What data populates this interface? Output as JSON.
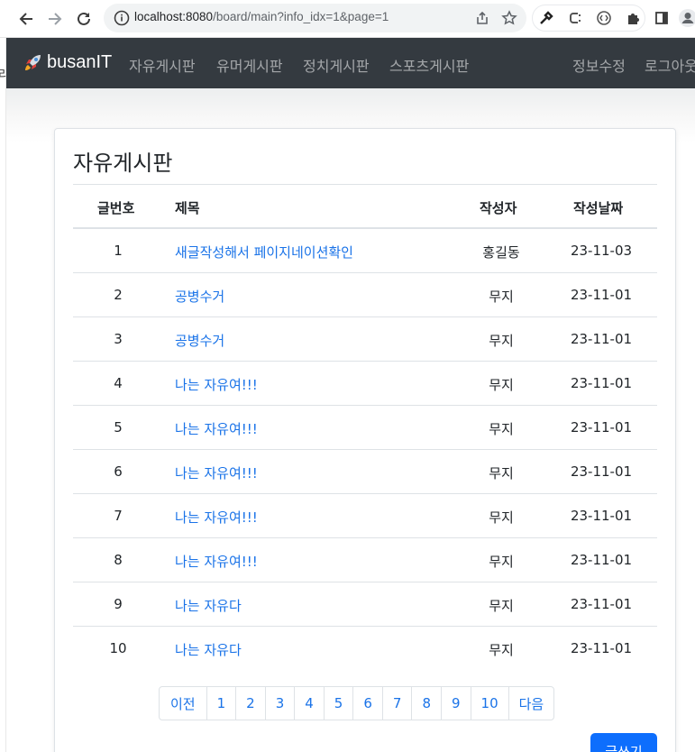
{
  "browser": {
    "url_host": "localhost:8080",
    "url_path": "/board/main?info_idx=1&page=1"
  },
  "left_strip_char": "리",
  "navbar": {
    "brand": "busanIT",
    "links": [
      "자유게시판",
      "유머게시판",
      "정치게시판",
      "스포츠게시판"
    ],
    "right_links": [
      "정보수정",
      "로그아웃"
    ]
  },
  "board": {
    "title": "자유게시판",
    "columns": [
      "글번호",
      "제목",
      "작성자",
      "작성날짜"
    ],
    "rows": [
      {
        "num": "1",
        "title": "새글작성해서 페이지네이션확인",
        "author": "홍길동",
        "date": "23-11-03"
      },
      {
        "num": "2",
        "title": "공병수거",
        "author": "무지",
        "date": "23-11-01"
      },
      {
        "num": "3",
        "title": "공병수거",
        "author": "무지",
        "date": "23-11-01"
      },
      {
        "num": "4",
        "title": "나는 자유여!!!",
        "author": "무지",
        "date": "23-11-01"
      },
      {
        "num": "5",
        "title": "나는 자유여!!!",
        "author": "무지",
        "date": "23-11-01"
      },
      {
        "num": "6",
        "title": "나는 자유여!!!",
        "author": "무지",
        "date": "23-11-01"
      },
      {
        "num": "7",
        "title": "나는 자유여!!!",
        "author": "무지",
        "date": "23-11-01"
      },
      {
        "num": "8",
        "title": "나는 자유여!!!",
        "author": "무지",
        "date": "23-11-01"
      },
      {
        "num": "9",
        "title": "나는 자유다",
        "author": "무지",
        "date": "23-11-01"
      },
      {
        "num": "10",
        "title": "나는 자유다",
        "author": "무지",
        "date": "23-11-01"
      }
    ]
  },
  "pagination": {
    "prev": "이전",
    "pages": [
      "1",
      "2",
      "3",
      "4",
      "5",
      "6",
      "7",
      "8",
      "9",
      "10"
    ],
    "next": "다음"
  },
  "write_button": "글쓰기",
  "colors": {
    "navbar": "#343a40",
    "link": "#1a73e8",
    "primary_button": "#0d6efd"
  }
}
